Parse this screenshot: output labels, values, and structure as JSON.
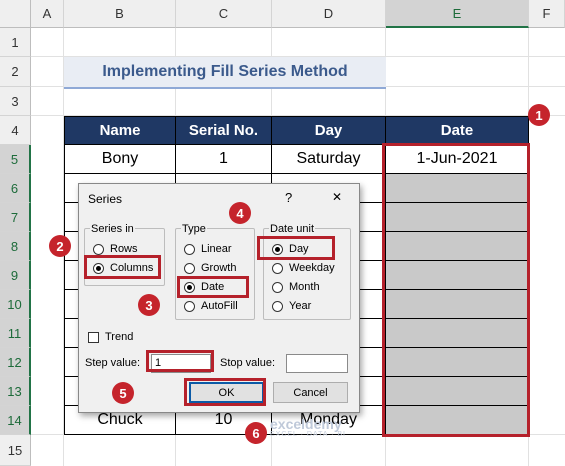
{
  "columns": [
    "A",
    "B",
    "C",
    "D",
    "E",
    "F"
  ],
  "rows": [
    "1",
    "2",
    "3",
    "4",
    "5",
    "6",
    "7",
    "8",
    "9",
    "10",
    "11",
    "12",
    "13",
    "14",
    "15"
  ],
  "title": "Implementing Fill Series Method",
  "table": {
    "headers": [
      "Name",
      "Serial No.",
      "Day",
      "Date"
    ],
    "row5": {
      "name": "Bony",
      "serial": "1",
      "day": "Saturday",
      "date": "1-Jun-2021"
    },
    "row14": {
      "name": "Chuck",
      "serial": "10",
      "day": "Monday"
    }
  },
  "dialog": {
    "title": "Series",
    "help": "?",
    "close": "✕",
    "series_in": {
      "label": "Series in",
      "rows": "Rows",
      "columns": "Columns",
      "selected": "Columns"
    },
    "type": {
      "label": "Type",
      "linear": "Linear",
      "growth": "Growth",
      "date": "Date",
      "autofill": "AutoFill",
      "selected": "Date"
    },
    "date_unit": {
      "label": "Date unit",
      "day": "Day",
      "weekday": "Weekday",
      "month": "Month",
      "year": "Year",
      "selected": "Day"
    },
    "trend": "Trend",
    "step_label": "Step value:",
    "step_value": "1",
    "stop_label": "Stop value:",
    "stop_value": "",
    "ok": "OK",
    "cancel": "Cancel"
  },
  "badges": [
    "1",
    "2",
    "3",
    "4",
    "5",
    "6"
  ],
  "watermark": {
    "name": "exceldemy",
    "tagline": "EXCEL · DATA · BI"
  },
  "colors": {
    "accent": "#c5242c",
    "header_fill": "#1f3864",
    "selection_fill": "#c9c9c9"
  }
}
